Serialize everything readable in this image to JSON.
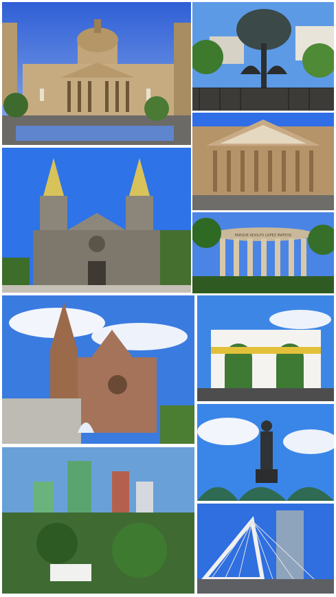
{
  "page": {
    "background": "#ffffff"
  },
  "tiles": [
    {
      "id": "cathedral-museum",
      "subject": "domed neoclassical building with plaza fountain",
      "accent": "#3f6fd8"
    },
    {
      "id": "tree-fountain",
      "subject": "bronze tree with two lions fountain",
      "accent": "#4a8ee0"
    },
    {
      "id": "theater-facade",
      "subject": "neoclassical theater facade with columns and pediment",
      "accent": "#2f6ee6"
    },
    {
      "id": "cathedral-towers",
      "subject": "cathedral with twin yellow-tiled spires",
      "accent": "#2e73e8"
    },
    {
      "id": "rotunda",
      "subject": "circular colonnade monument",
      "accent": "#4a84e4"
    },
    {
      "id": "gothic-church",
      "subject": "gothic temple with rose window and fountain",
      "accent": "#3a7be0"
    },
    {
      "id": "arches",
      "subject": "white triumphal arches over avenue",
      "accent": "#3d86e6"
    },
    {
      "id": "skyline",
      "subject": "city skyline with green high-rise towers and trees",
      "accent": "#6aa0d8"
    },
    {
      "id": "minerva-statue",
      "subject": "statue on pedestal surrounded by agave plants",
      "accent": "#3a86e8"
    },
    {
      "id": "cable-bridge",
      "subject": "white cable-stayed bridge arch and skyscraper",
      "accent": "#2f6fe0"
    }
  ],
  "signage": {
    "rotunda_inscription": "PARQUE ADOLFO LOPEZ MATEOS"
  }
}
